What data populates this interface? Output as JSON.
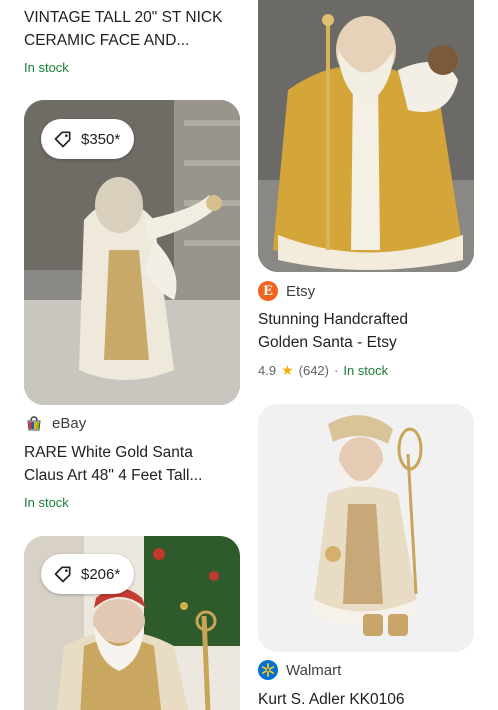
{
  "items": {
    "item1": {
      "title_line1": "VINTAGE TALL 20\" ST NICK",
      "title_line2": "CERAMIC FACE AND...",
      "stock": "In stock"
    },
    "item2": {
      "price": "$350*",
      "source": "eBay",
      "title_line1": "RARE White Gold Santa",
      "title_line2": "Claus Art 48\" 4 Feet Tall...",
      "stock": "In stock"
    },
    "item3": {
      "price": "$206*"
    },
    "item4": {
      "source_initial": "E",
      "source": "Etsy",
      "title_line1": "Stunning Handcrafted",
      "title_line2": "Golden Santa - Etsy",
      "rating": "4.9",
      "reviews": "(642)",
      "separator": "·",
      "stock": "In stock"
    },
    "item5": {
      "source": "Walmart",
      "title_line1": "Kurt S. Adler KK0106"
    }
  },
  "icons": {
    "price_tag": "tag-icon",
    "ebay": "ebay-logo-icon",
    "etsy": "etsy-logo-icon",
    "walmart": "walmart-logo-icon",
    "star": "star-icon"
  },
  "colors": {
    "stock_green": "#188038",
    "star_yellow": "#f9ab00",
    "etsy_orange": "#f1641e",
    "walmart_blue": "#0071ce"
  }
}
